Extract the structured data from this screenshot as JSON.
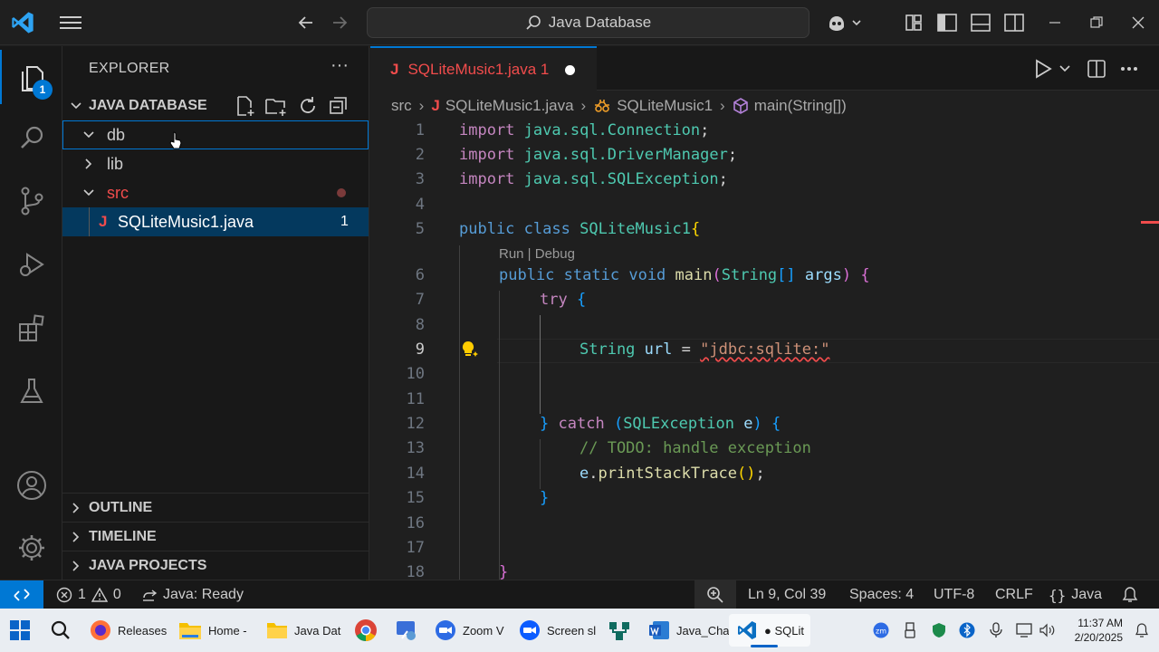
{
  "titlebar": {
    "search_text": "Java Database"
  },
  "activitybar": {
    "explorer_badge": "1"
  },
  "sidebar": {
    "title": "EXPLORER",
    "more": "···",
    "project": "JAVA DATABASE",
    "tree": [
      {
        "label": "db"
      },
      {
        "label": "lib"
      },
      {
        "label": "src"
      },
      {
        "label": "SQLiteMusic1.java",
        "file_icon": "J",
        "problems": "1"
      }
    ],
    "sections": [
      "OUTLINE",
      "TIMELINE",
      "JAVA PROJECTS"
    ]
  },
  "editor": {
    "tab": {
      "icon": "J",
      "label": "SQLiteMusic1.java 1"
    },
    "breadcrumb": {
      "folder": "src",
      "file_icon": "J",
      "file": "SQLiteMusic1.java",
      "class": "SQLiteMusic1",
      "method": "main(String[])"
    },
    "line_numbers": [
      "1",
      "2",
      "3",
      "4",
      "5",
      "6",
      "7",
      "8",
      "9",
      "10",
      "11",
      "12",
      "13",
      "14",
      "15",
      "16",
      "17",
      "18"
    ],
    "codelens": "Run | Debug",
    "code": {
      "import_kw": "import",
      "l1_pkg": "java.sql.",
      "l1_cls": "Connection",
      "l2_cls": "DriverManager",
      "l3_cls": "SQLException",
      "public_kw": "public",
      "class_kw": "class",
      "class_name": "SQLiteMusic1",
      "static_kw": "static",
      "void_kw": "void",
      "main_fn": "main",
      "string_ty": "String",
      "args_var": "args",
      "try_kw": "try",
      "url_var": "url",
      "url_str": "\"jdbc:sqlite:\"",
      "catch_kw": "catch",
      "e_var": "e",
      "comment": "// TODO: handle exception",
      "print_fn": "printStackTrace"
    }
  },
  "statusbar": {
    "errors": "1",
    "warnings": "0",
    "java_status": "Java: Ready",
    "position": "Ln 9, Col 39",
    "spaces": "Spaces: 4",
    "encoding": "UTF-8",
    "eol": "CRLF",
    "language": "Java"
  },
  "taskbar": {
    "apps": [
      "Releases",
      "Home -",
      "Java Dat",
      "Zoom V",
      "Screen sl",
      "Java_Cha",
      "SQLit"
    ],
    "time": "11:37 AM",
    "date": "2/20/2025"
  },
  "colors": {
    "accent": "#0078d4",
    "java_icon": "#f14c4c",
    "selection": "#04395e"
  }
}
